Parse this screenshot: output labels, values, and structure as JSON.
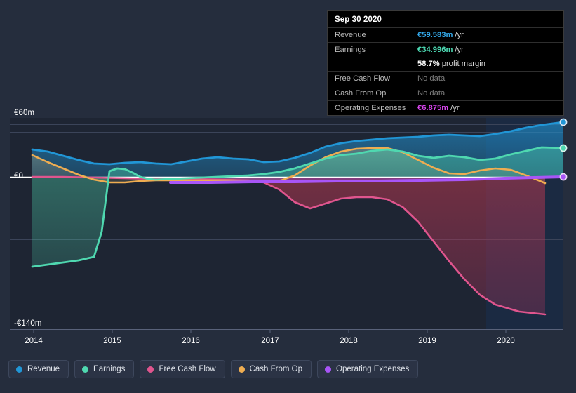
{
  "axes": {
    "y_top_label": "€60m",
    "y_zero_label": "€0",
    "y_bottom_label": "-€140m",
    "x_labels": [
      "2014",
      "2015",
      "2016",
      "2017",
      "2018",
      "2019",
      "2020"
    ]
  },
  "tooltip": {
    "title": "Sep 30 2020",
    "rows": [
      {
        "key": "Revenue",
        "value": "€59.583m",
        "unit": "/yr",
        "color": "#33a7e8"
      },
      {
        "key": "Earnings",
        "value": "€34.996m",
        "unit": "/yr",
        "color": "#4ddbb4"
      },
      {
        "key": "",
        "value": "58.7%",
        "unit": "profit margin",
        "color": "#ffffff"
      },
      {
        "key": "Free Cash Flow",
        "value": "No data",
        "unit": "",
        "color": "#7d7d7d"
      },
      {
        "key": "Cash From Op",
        "value": "No data",
        "unit": "",
        "color": "#7d7d7d"
      },
      {
        "key": "Operating Expenses",
        "value": "€6.875m",
        "unit": "/yr",
        "color": "#d946ef"
      }
    ]
  },
  "legend": {
    "items": [
      {
        "label": "Revenue",
        "color": "#2196d6"
      },
      {
        "label": "Earnings",
        "color": "#4fd8b0"
      },
      {
        "label": "Free Cash Flow",
        "color": "#e0558e"
      },
      {
        "label": "Cash From Op",
        "color": "#efad51"
      },
      {
        "label": "Operating Expenses",
        "color": "#a855f7"
      }
    ]
  },
  "chart_data": {
    "type": "area",
    "title": "",
    "xlabel": "",
    "ylabel": "",
    "ylim": [
      -140,
      60
    ],
    "xlim": [
      "2014",
      "2020.75"
    ],
    "grid": true,
    "legend_position": "bottom",
    "currency": "EUR",
    "units": "millions per year",
    "x_tick_labels": [
      "2014",
      "2015",
      "2016",
      "2017",
      "2018",
      "2019",
      "2020"
    ],
    "y_tick_labels": [
      "€60m",
      "€0",
      "-€140m"
    ],
    "forecast_band_start": "2020.0",
    "series": [
      {
        "name": "Revenue",
        "color": "#2196d6",
        "x": [
          2014.0,
          2014.25,
          2014.5,
          2014.75,
          2015.0,
          2015.25,
          2015.5,
          2015.75,
          2016.0,
          2016.25,
          2016.5,
          2016.75,
          2017.0,
          2017.25,
          2017.5,
          2017.75,
          2018.0,
          2018.25,
          2018.5,
          2018.75,
          2019.0,
          2019.25,
          2019.5,
          2019.75,
          2020.0,
          2020.25,
          2020.5,
          2020.75
        ],
        "values": [
          26,
          24,
          21,
          17,
          14,
          15,
          16,
          15,
          14,
          16,
          18,
          19,
          17,
          17,
          20,
          22,
          28,
          32,
          35,
          36,
          38,
          39,
          40,
          39,
          41,
          46,
          53,
          59.583
        ]
      },
      {
        "name": "Earnings",
        "color": "#4fd8b0",
        "x": [
          2014.0,
          2014.25,
          2014.5,
          2014.75,
          2015.0,
          2015.25,
          2015.5,
          2015.75,
          2016.0,
          2016.25,
          2016.5,
          2016.75,
          2017.0,
          2017.25,
          2017.5,
          2017.75,
          2018.0,
          2018.25,
          2018.5,
          2018.75,
          2019.0,
          2019.25,
          2019.5,
          2019.75,
          2020.0,
          2020.25,
          2020.5,
          2020.75
        ],
        "values": [
          -92,
          -89,
          -86,
          -83,
          -78,
          -20,
          5,
          2,
          -2,
          -1,
          1,
          2,
          3,
          3,
          4,
          6,
          10,
          14,
          18,
          20,
          17,
          19,
          18,
          16,
          19,
          24,
          30,
          34.996
        ]
      },
      {
        "name": "Free Cash Flow",
        "color": "#e0558e",
        "x": [
          2014.0,
          2014.5,
          2015.0,
          2015.5,
          2016.0,
          2016.5,
          2017.0,
          2017.25,
          2017.5,
          2017.75,
          2018.0,
          2018.25,
          2018.5,
          2018.75,
          2019.0,
          2019.25,
          2019.5,
          2019.75,
          2020.0,
          2020.25,
          2020.5
        ],
        "values": [
          0,
          0,
          -1,
          -2,
          -2,
          -2,
          -4,
          -12,
          -24,
          -30,
          -25,
          -20,
          -19,
          -19,
          -22,
          -36,
          -58,
          -80,
          -100,
          -118,
          -133
        ]
      },
      {
        "name": "Cash From Op",
        "color": "#efad51",
        "x": [
          2014.0,
          2014.25,
          2014.5,
          2014.75,
          2015.0,
          2015.25,
          2015.5,
          2015.75,
          2016.0,
          2016.25,
          2016.5,
          2016.75,
          2017.0,
          2017.25,
          2017.5,
          2017.75,
          2018.0,
          2018.25,
          2018.5,
          2018.75,
          2019.0,
          2019.25,
          2019.5,
          2019.75,
          2020.0,
          2020.25,
          2020.5
        ],
        "values": [
          21,
          14,
          8,
          2,
          -3,
          -6,
          -6,
          -4,
          -3,
          -3,
          -3,
          -3,
          -3,
          -3,
          -4,
          -5,
          2,
          14,
          25,
          30,
          24,
          12,
          5,
          4,
          9,
          11,
          2
        ]
      },
      {
        "name": "Operating Expenses",
        "color": "#a855f7",
        "x": [
          2015.6,
          2016.0,
          2016.5,
          2017.0,
          2017.5,
          2018.0,
          2018.5,
          2019.0,
          2019.5,
          2020.0,
          2020.75
        ],
        "values": [
          1.5,
          1.6,
          1.8,
          2.0,
          2.2,
          2.5,
          3.0,
          3.6,
          4.4,
          5.4,
          6.875
        ]
      }
    ]
  }
}
